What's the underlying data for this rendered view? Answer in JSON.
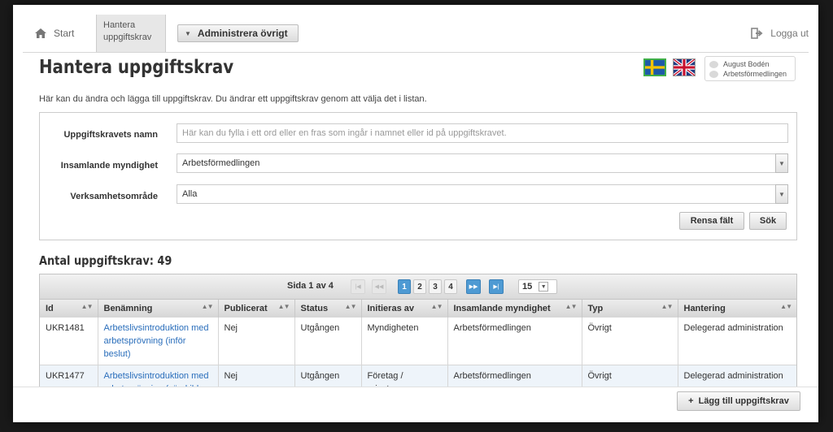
{
  "nav": {
    "start_label": "Start",
    "active_tab_label": "Hantera uppgiftskrav",
    "admin_menu_label": "Administrera övrigt",
    "logout_label": "Logga ut"
  },
  "header": {
    "title": "Hantera uppgiftskrav",
    "intro": "Här kan du ändra och lägga till uppgiftskrav. Du ändrar ett uppgiftskrav genom att välja det i listan.",
    "user_name": "August Bodén",
    "user_org": "Arbetsförmedlingen"
  },
  "search": {
    "name_label": "Uppgiftskravets namn",
    "name_placeholder": "Här kan du fylla i ett ord eller en fras som ingår i namnet eller id på uppgiftskravet.",
    "authority_label": "Insamlande myndighet",
    "authority_value": "Arbetsförmedlingen",
    "area_label": "Verksamhetsområde",
    "area_value": "Alla",
    "clear_label": "Rensa fält",
    "search_label": "Sök"
  },
  "count_label": "Antal uppgiftskrav: 49",
  "pager": {
    "info": "Sida 1 av 4",
    "pages": [
      "1",
      "2",
      "3",
      "4"
    ],
    "current_page": 1,
    "rows_per_page": "15"
  },
  "table": {
    "columns": [
      "Id",
      "Benämning",
      "Publicerat",
      "Status",
      "Initieras av",
      "Insamlande myndighet",
      "Typ",
      "Hantering"
    ],
    "rows": [
      {
        "id": "UKR1481",
        "name": "Arbetslivsintroduktion med arbetsprövning (inför beslut)",
        "published": "Nej",
        "status": "Utgången",
        "initiated_by": "Myndigheten",
        "authority": "Arbetsförmedlingen",
        "type": "Övrigt",
        "handling": "Delegerad administration"
      },
      {
        "id": "UKR1477",
        "name": "Arbetslivsintroduktion med arbetsprövning (särskild ersättning)",
        "published": "Nej",
        "status": "Utgången",
        "initiated_by": "Företag / privatperson",
        "authority": "Arbetsförmedlingen",
        "type": "Övrigt",
        "handling": "Delegerad administration"
      }
    ]
  },
  "add_button_label": "Lägg till uppgiftskrav",
  "colors": {
    "accent": "#4e9ad3",
    "link": "#2a6ebb",
    "row_alt": "#eef4fa"
  }
}
